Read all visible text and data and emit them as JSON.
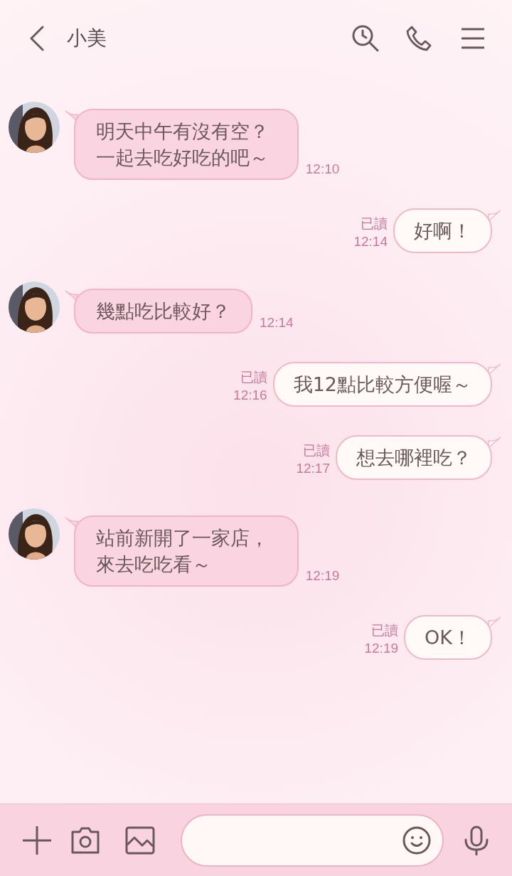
{
  "header": {
    "title": "小美"
  },
  "messages": [
    {
      "kind": "received",
      "text": "明天中午有沒有空？一起去吃好吃的吧～",
      "time": "12:10"
    },
    {
      "kind": "sent",
      "text": "好啊！",
      "read": "已讀",
      "time": "12:14"
    },
    {
      "kind": "received",
      "text": "幾點吃比較好？",
      "time": "12:14"
    },
    {
      "kind": "sent",
      "text": "我12點比較方便喔～",
      "read": "已讀",
      "time": "12:16"
    },
    {
      "kind": "sent",
      "text": "想去哪裡吃？",
      "read": "已讀",
      "time": "12:17"
    },
    {
      "kind": "received",
      "text": "站前新開了一家店，來去吃吃看～",
      "time": "12:19"
    },
    {
      "kind": "sent",
      "text": "OK！",
      "read": "已讀",
      "time": "12:19"
    }
  ]
}
